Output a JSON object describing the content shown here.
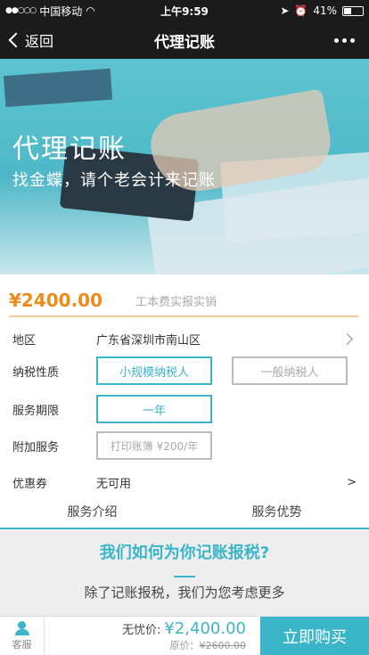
{
  "status_bar": {
    "carrier": "中国移动",
    "time": "上午9:59",
    "battery": "41%"
  },
  "nav": {
    "back_label": "返回",
    "title": "代理记账"
  },
  "hero": {
    "heading": "代理记账",
    "subheading": "找金蝶，请个老会计来记账"
  },
  "price": {
    "amount": "¥2400.00",
    "note": "工本费实报实销"
  },
  "form": {
    "region_label": "地区",
    "region_value": "广东省深圳市南山区",
    "tax_label": "纳税性质",
    "tax_options": [
      "小规模纳税人",
      "一般纳税人"
    ],
    "term_label": "服务期限",
    "term_option": "一年",
    "addon_label": "附加服务",
    "addon_option": "打印账簿 ¥200/年",
    "coupon_label": "优惠券",
    "coupon_value": "无可用",
    "coupon_arrow": ">"
  },
  "tabs": [
    "服务介绍",
    "服务优势"
  ],
  "intro": {
    "question": "我们如何为你记账报税?",
    "desc": "除了记账报税，我们为您考虑更多"
  },
  "bottom_bar": {
    "service_label": "客服",
    "price_label": "无忧价:",
    "price_value": "¥2,400.00",
    "original_label": "原价：",
    "original_value": "¥2600.00",
    "buy_label": "立即购买"
  },
  "colors": {
    "accent": "#3bb6c8",
    "price": "#f08b1a",
    "topbar": "#1b1b1b"
  }
}
